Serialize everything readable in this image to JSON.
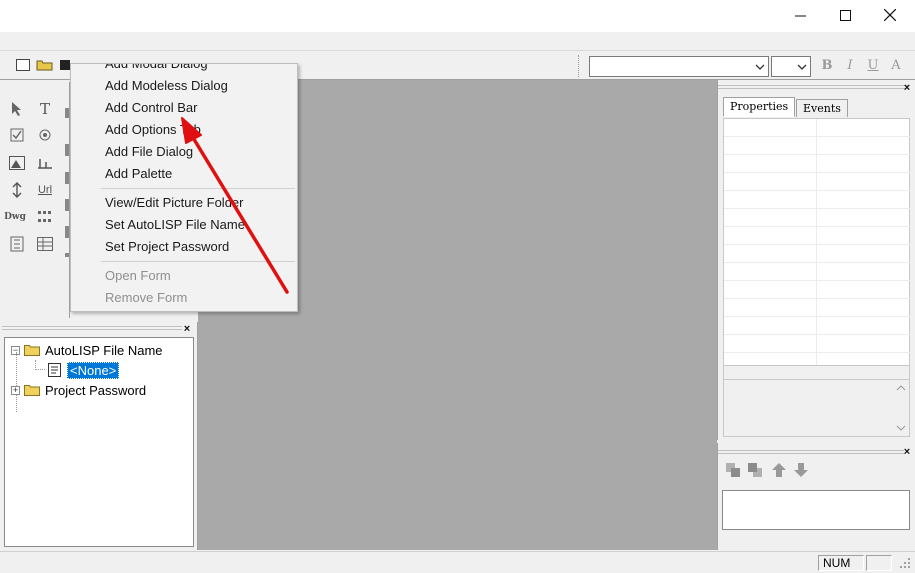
{
  "window": {
    "minimize_glyph": "—",
    "maximize_glyph": "☐",
    "close_glyph": "✕"
  },
  "toolbar": {
    "font_combo_value": "",
    "size_combo_value": "",
    "bold_label": "B",
    "italic_label": "I",
    "underline_label": "U",
    "extra_label": "A"
  },
  "palette": {
    "icons": [
      "pointer-icon",
      "text-icon",
      "edit-icon",
      "checkbox-icon",
      "radio-icon",
      "list-icon",
      "image-icon",
      "slider-icon",
      "combo-icon",
      "spin-icon",
      "url-icon",
      "circle-icon",
      "dwg-icon",
      "grid-icon",
      "tab-icon",
      "frame-icon",
      "table-icon",
      "panel-icon"
    ],
    "text_icons": {
      "text": "T",
      "url": "Url",
      "dwg": "Dwg"
    }
  },
  "context_menu": {
    "items": [
      {
        "label": "Add Modal Dialog",
        "enabled": true
      },
      {
        "label": "Add Modeless Dialog",
        "enabled": true
      },
      {
        "label": "Add Control Bar",
        "enabled": true
      },
      {
        "label": "Add Options Tab",
        "enabled": true
      },
      {
        "label": "Add File Dialog",
        "enabled": true
      },
      {
        "label": "Add Palette",
        "enabled": true
      },
      {
        "label": "View/Edit Picture Folder",
        "enabled": true
      },
      {
        "label": "Set AutoLISP File Name",
        "enabled": true
      },
      {
        "label": "Set Project Password",
        "enabled": true
      },
      {
        "label": "Open Form",
        "enabled": false
      },
      {
        "label": "Remove Form",
        "enabled": false
      }
    ]
  },
  "properties_panel": {
    "tabs": [
      "Properties",
      "Events"
    ],
    "active_tab": "Properties",
    "close_glyph": "×"
  },
  "tree": {
    "close_glyph": "×",
    "items": [
      {
        "label": "AutoLISP File Name",
        "expander": "−",
        "child": "<None>"
      },
      {
        "label": "Project Password",
        "expander": "+"
      }
    ]
  },
  "lower_panel": {
    "close_glyph": "×",
    "buttons": [
      "layer-back-icon",
      "layer-forward-icon",
      "move-up-icon",
      "move-down-icon"
    ]
  },
  "statusbar": {
    "num_indicator": "NUM"
  },
  "colors": {
    "client_area": "#a9a9a9",
    "selection": "#0078d7",
    "annotation_arrow": "#e01010"
  }
}
